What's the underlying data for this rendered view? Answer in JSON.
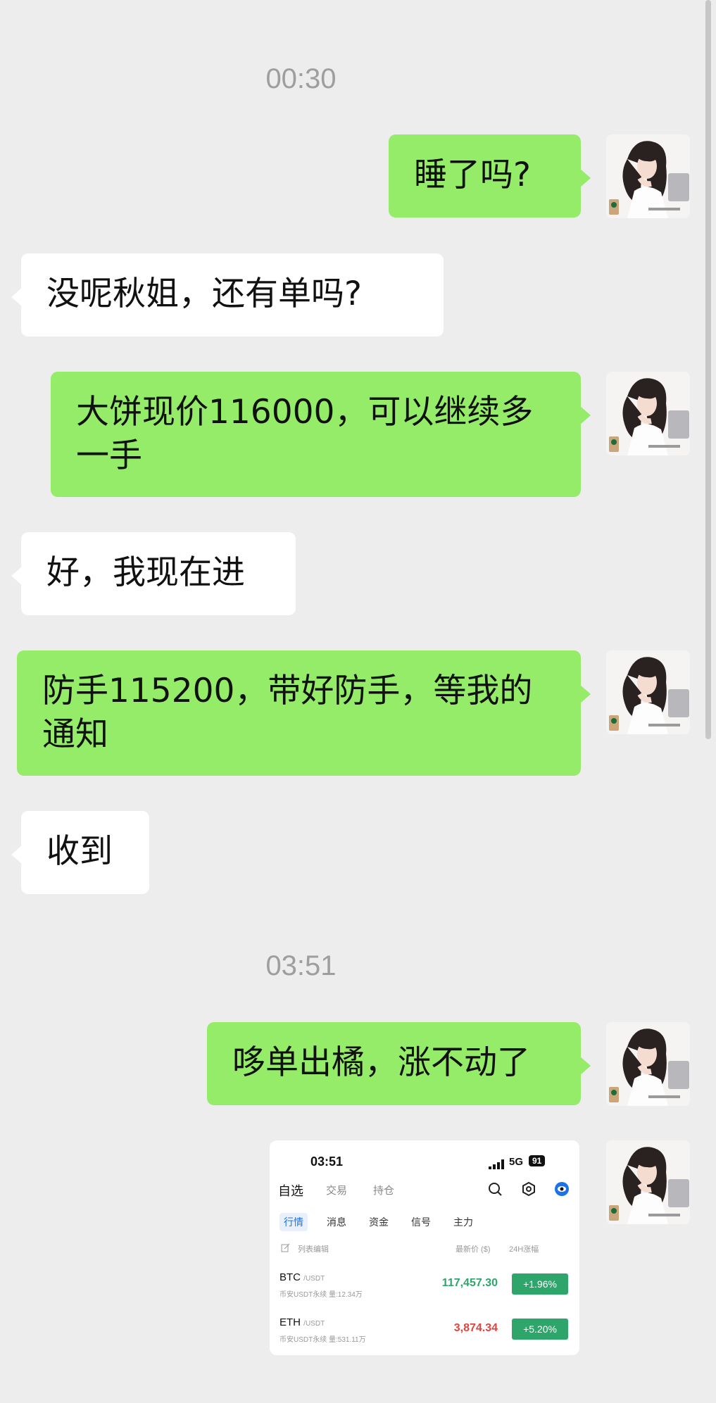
{
  "timestamps": [
    "00:30",
    "03:51"
  ],
  "messages": [
    {
      "side": "out",
      "text": "睡了吗?"
    },
    {
      "side": "in",
      "text": "没呢秋姐，还有单吗?"
    },
    {
      "side": "out",
      "text": "大饼现价116000，可以继续多一手"
    },
    {
      "side": "in",
      "text": "好，我现在进"
    },
    {
      "side": "out",
      "text": "防手115200，带好防手，等我的通知"
    },
    {
      "side": "in",
      "text": "收到"
    },
    {
      "side": "out",
      "text": "哆单出橘，涨不动了"
    }
  ],
  "avatar_icon": "woman-avatar-icon",
  "screenshot": {
    "status_time": "03:51",
    "network": "5G",
    "battery": "91",
    "tabs": [
      "自选",
      "交易",
      "持仓"
    ],
    "subtabs": [
      "行情",
      "消息",
      "资金",
      "信号",
      "主力"
    ],
    "list_edit": "列表编辑",
    "col_price": "最新价 ($)",
    "col_change": "24H涨幅",
    "rows": [
      {
        "symbol": "BTC",
        "quote": "/USDT",
        "desc": "币安USDT永续 量:12.34万",
        "price": "117,457.30",
        "price_color": "#2ea56a",
        "change": "+1.96%"
      },
      {
        "symbol": "ETH",
        "quote": "/USDT",
        "desc": "币安USDT永续 量:531.11万",
        "price": "3,874.34",
        "price_color": "#e0443e",
        "change": "+5.20%"
      }
    ]
  },
  "colors": {
    "bubble_out": "#95ec69",
    "bubble_in": "#ffffff",
    "background": "#ededed"
  }
}
